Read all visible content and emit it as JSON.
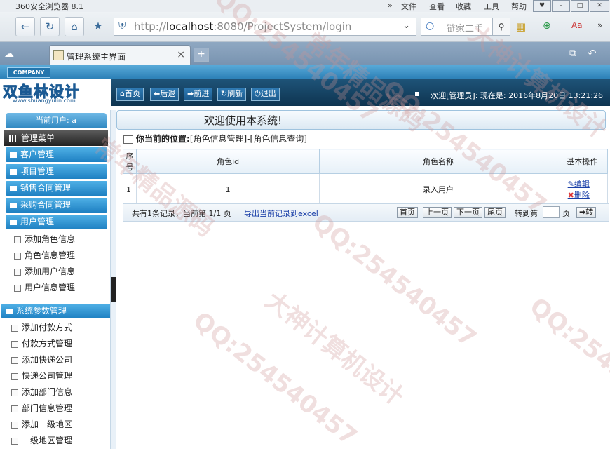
{
  "browser": {
    "title": "360安全浏览器 8.1",
    "menu": [
      "»",
      "文件",
      "查看",
      "收藏",
      "工具",
      "帮助"
    ],
    "url_host": "localhost",
    "url_rest": ":8080/ProjectSystem/login",
    "url_prefix": "http://",
    "search_placeholder": "链家二手",
    "tab_label": "管理系统主界面",
    "tab_close": "×",
    "new_tab": "+"
  },
  "app": {
    "company_badge": "COMPANY",
    "logo_text": "双鱼林设计",
    "logo_url": "www.shuangyulin.com",
    "nav_buttons": [
      "首页",
      "后退",
      "前进",
      "刷新",
      "退出"
    ],
    "welcome": "欢迎[管理员]:    现在是: 2016年8月20日 13:21:26",
    "main_title": "欢迎使用本系统!"
  },
  "sidebar": {
    "current_user": "当前用户: a",
    "menu_header": "管理菜单",
    "groups": [
      "客户管理",
      "项目管理",
      "销售合同管理",
      "采购合同管理",
      "用户管理"
    ],
    "user_items": [
      "添加角色信息",
      "角色信息管理",
      "添加用户信息",
      "用户信息管理"
    ],
    "sys_group": "系统参数管理",
    "sys_items": [
      "添加付款方式",
      "付款方式管理",
      "添加快递公司",
      "快递公司管理",
      "添加部门信息",
      "部门信息管理",
      "添加一级地区",
      "一级地区管理"
    ]
  },
  "content": {
    "position_label": "你当前的位置:",
    "position_path": "[角色信息管理]-[角色信息查询]",
    "columns": [
      "序号",
      "角色id",
      "角色名称",
      "基本操作"
    ],
    "rows": [
      {
        "no": "1",
        "role_id": "1",
        "role_name": "录入用户",
        "edit": "编辑",
        "delete": "删除"
      }
    ],
    "summary": "共有1条记录，当前第 1/1 页",
    "export": "导出当前记录到excel",
    "pager": [
      "首页",
      "上一页",
      "下一页",
      "尾页"
    ],
    "goto_label": "转到第",
    "page_unit": "页",
    "go_button": "➡转"
  },
  "watermark": [
    "QQ:254540457",
    "大神计算机设计",
    "常年精品源码"
  ]
}
